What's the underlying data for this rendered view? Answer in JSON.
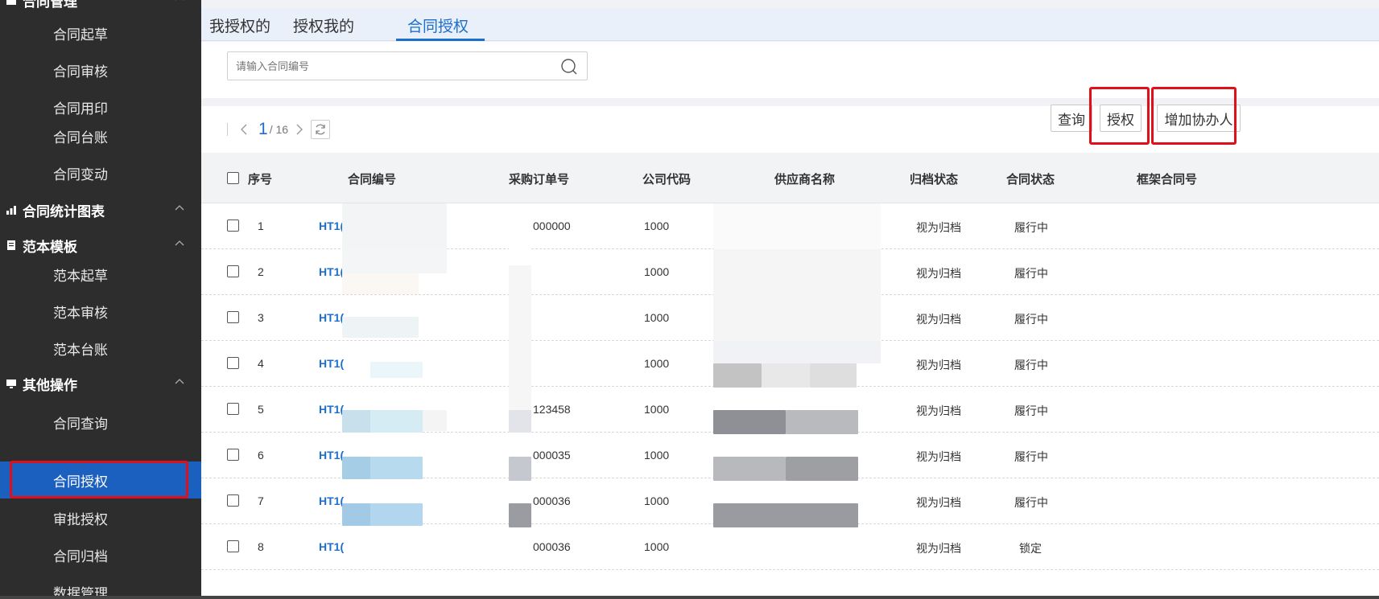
{
  "sidebar": {
    "groups": [
      {
        "label": "合同管理",
        "icon": "folder-icon",
        "items": [
          "合同起草",
          "合同审核",
          "合同用印",
          "合同台账",
          "合同变动"
        ]
      },
      {
        "label": "合同统计图表",
        "icon": "chart-icon",
        "items": []
      },
      {
        "label": "范本模板",
        "icon": "document-icon",
        "items": [
          "范本起草",
          "范本审核",
          "范本台账"
        ]
      },
      {
        "label": "其他操作",
        "icon": "monitor-icon",
        "items": [
          "合同查询",
          "合同授权",
          "审批授权",
          "合同归档",
          "数据管理"
        ]
      }
    ],
    "active_item": "合同授权"
  },
  "tabs": [
    "我授权的",
    "授权我的",
    "合同授权"
  ],
  "active_tab": "合同授权",
  "search": {
    "placeholder": "请输入合同编号",
    "value": ""
  },
  "pager": {
    "current": "1",
    "total": "/ 16"
  },
  "toolbar": {
    "query_label": "查询",
    "authorize_label": "授权",
    "add_assistant_label": "增加协办人"
  },
  "table": {
    "headers": [
      "序号",
      "合同编号",
      "采购订单号",
      "公司代码",
      "供应商名称",
      "归档状态",
      "合同状态",
      "框架合同号"
    ],
    "rows": [
      {
        "no": "1",
        "contract": "HT1(",
        "po": "000000",
        "company": "1000",
        "archive": "视为归档",
        "status": "履行中"
      },
      {
        "no": "2",
        "contract": "HT1(",
        "po": "",
        "company": "1000",
        "archive": "视为归档",
        "status": "履行中"
      },
      {
        "no": "3",
        "contract": "HT1(",
        "po": "",
        "company": "1000",
        "archive": "视为归档",
        "status": "履行中"
      },
      {
        "no": "4",
        "contract": "HT1(",
        "po": "",
        "company": "1000",
        "archive": "视为归档",
        "status": "履行中"
      },
      {
        "no": "5",
        "contract": "HT1(",
        "po": "123458",
        "company": "1000",
        "archive": "视为归档",
        "status": "履行中"
      },
      {
        "no": "6",
        "contract": "HT1(",
        "po": "000035",
        "company": "1000",
        "archive": "视为归档",
        "status": "履行中"
      },
      {
        "no": "7",
        "contract": "HT1(",
        "po": "000036",
        "company": "1000",
        "archive": "视为归档",
        "status": "履行中"
      },
      {
        "no": "8",
        "contract": "HT1(",
        "po": "000036",
        "company": "1000",
        "archive": "视为归档",
        "status": "锁定"
      }
    ]
  },
  "colors": {
    "accent": "#1d6fce",
    "highlight_red": "#e0101a",
    "sidebar_bg": "#2d2d2d",
    "active_bg": "#1b5fbf"
  }
}
